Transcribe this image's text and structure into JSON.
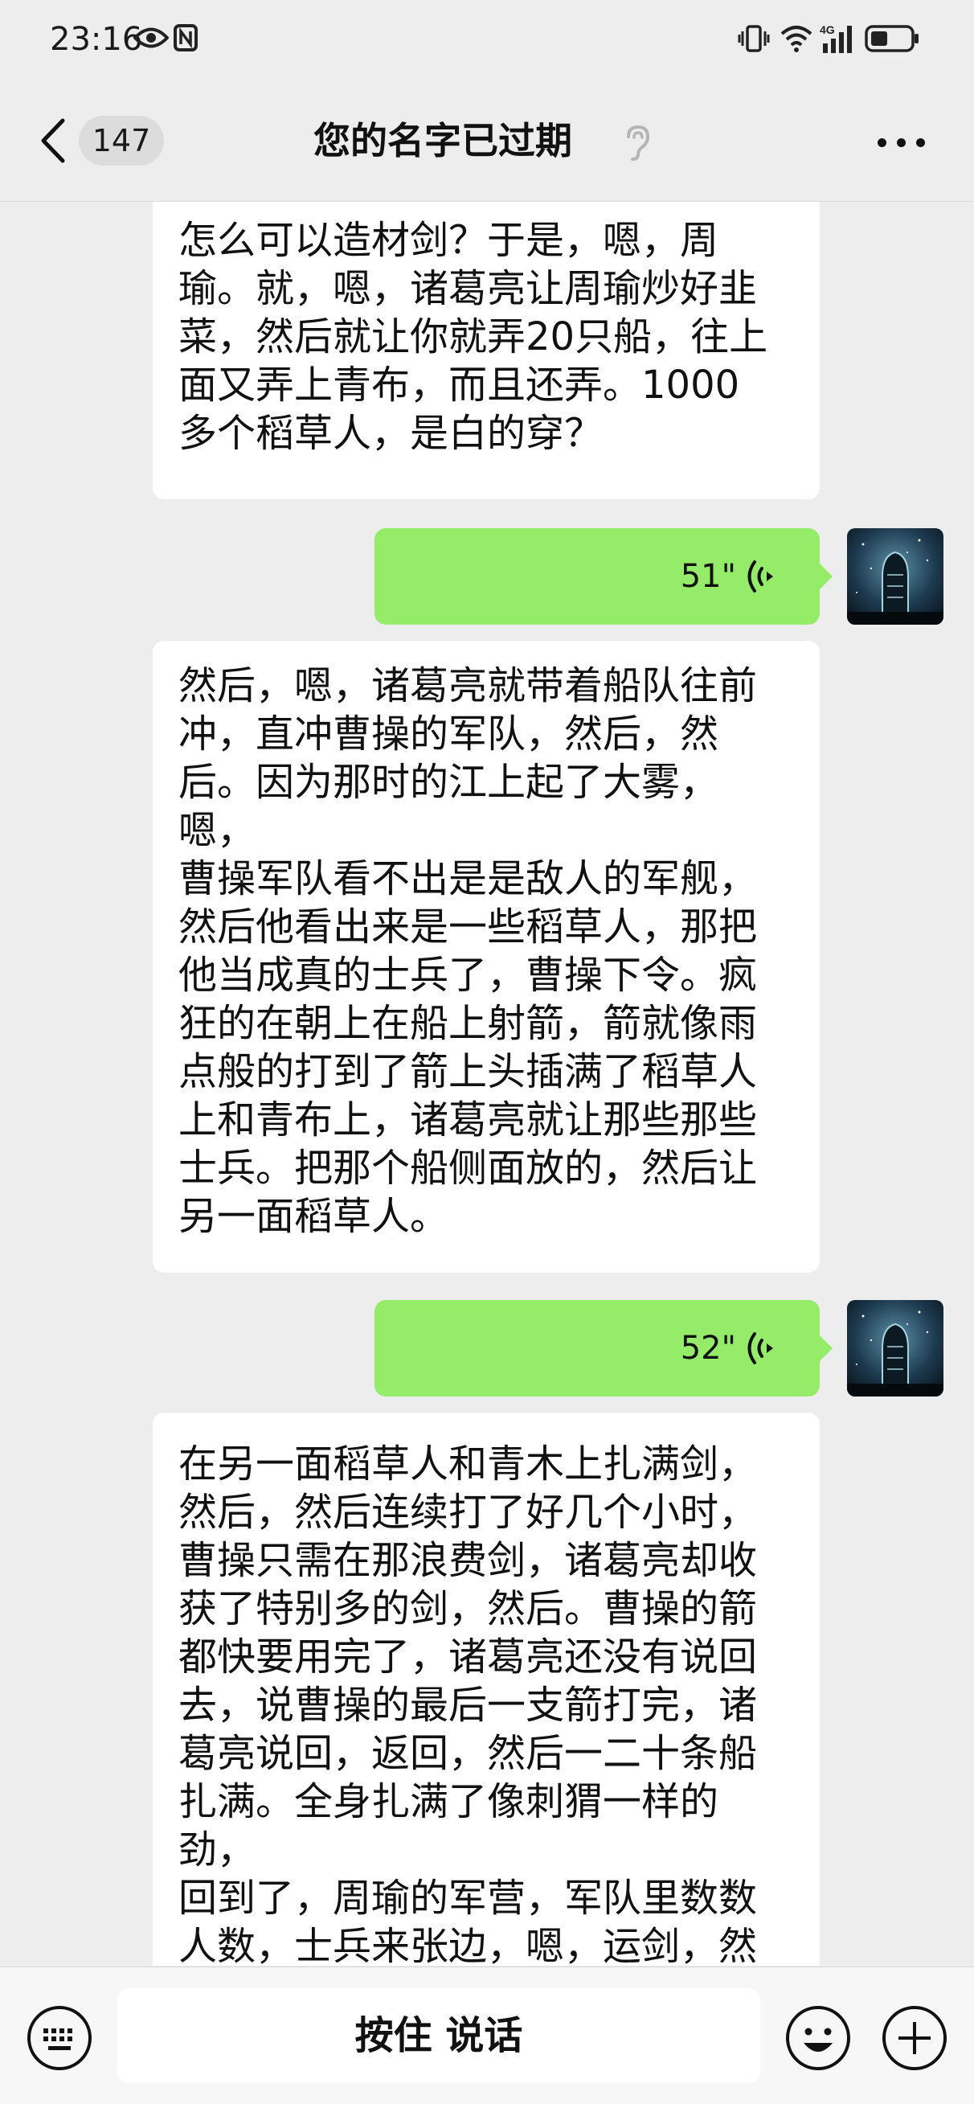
{
  "status_bar": {
    "time": "23:16"
  },
  "header": {
    "back_count": "147",
    "title": "您的名字已过期"
  },
  "messages": [
    {
      "type": "text_in",
      "text": "怎么可以造材剑？于是，嗯，周\n瑜。就，嗯，诸葛亮让周瑜炒好韭\n菜，然后就让你就弄20只船，往上\n面又弄上青布，而且还弄。1000\n多个稻草人，是白的穿？"
    },
    {
      "type": "voice_out",
      "duration": "51\""
    },
    {
      "type": "text_in",
      "text": "然后，嗯，诸葛亮就带着船队往前\n冲，直冲曹操的军队，然后，然\n后。因为那时的江上起了大雾，嗯，\n曹操军队看不出是是敌人的军舰，\n然后他看出来是一些稻草人，那把\n他当成真的士兵了，曹操下令。疯\n狂的在朝上在船上射箭，箭就像雨\n点般的打到了箭上头插满了稻草人\n上和青布上，诸葛亮就让那些那些\n士兵。把那个船侧面放的，然后让\n另一面稻草人。"
    },
    {
      "type": "voice_out",
      "duration": "52\""
    },
    {
      "type": "text_in",
      "text": "在另一面稻草人和青木上扎满剑，\n然后，然后连续打了好几个小时，\n曹操只需在那浪费剑，诸葛亮却收\n获了特别多的剑，然后。曹操的箭\n都快要用完了，诸葛亮还没有说回\n去，说曹操的最后一支箭打完，诸\n葛亮说回，返回，然后一二十条船\n扎满。全身扎满了像刺猬一样的劲，\n回到了，周瑜的军营，军队里数数\n人数，士兵来张边，嗯，运剑，然"
    }
  ],
  "input_bar": {
    "hold_to_talk": "按住 说话"
  }
}
